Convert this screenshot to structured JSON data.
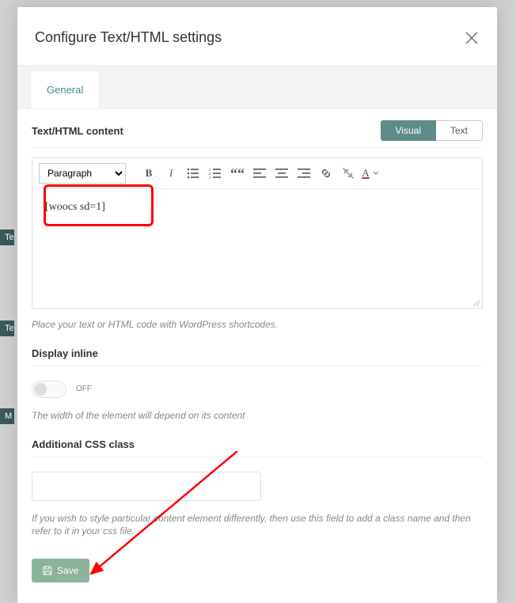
{
  "modal": {
    "title": "Configure Text/HTML settings",
    "tabs": [
      {
        "label": "General"
      }
    ]
  },
  "content": {
    "label": "Text/HTML content",
    "mode_visual": "Visual",
    "mode_text": "Text",
    "format": "Paragraph",
    "editor_text": "[woocs sd=1]",
    "helper": "Place your text or HTML code with WordPress shortcodes."
  },
  "display_inline": {
    "label": "Display inline",
    "toggle_state": "OFF",
    "helper": "The width of the element will depend on its content"
  },
  "css_class": {
    "label": "Additional CSS class",
    "value": "",
    "helper": "If you wish to style particular content element differently, then use this field to add a class name and then refer to it in your css file."
  },
  "actions": {
    "save_label": "Save"
  },
  "icons": {
    "bold": "B",
    "italic": "I",
    "quote": "““",
    "text_a": "A"
  }
}
